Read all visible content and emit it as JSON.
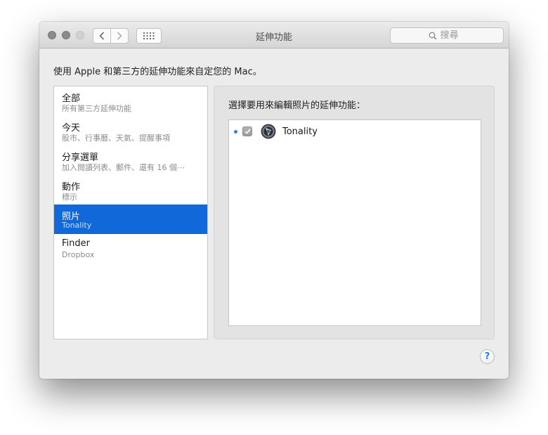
{
  "window": {
    "title": "延伸功能"
  },
  "search": {
    "placeholder": "搜尋"
  },
  "intro_text": "使用 Apple 和第三方的延伸功能來自定您的 Mac。",
  "sidebar": {
    "items": [
      {
        "title": "全部",
        "subtitle": "所有第三方延伸功能",
        "selected": false
      },
      {
        "title": "今天",
        "subtitle": "股市、行事曆、天氣、提醒事項",
        "selected": false
      },
      {
        "title": "分享選單",
        "subtitle": "加入閱讀列表、郵件、還有 16 個⋯",
        "selected": false
      },
      {
        "title": "動作",
        "subtitle": "標示",
        "selected": false
      },
      {
        "title": "照片",
        "subtitle": "Tonality",
        "selected": true
      },
      {
        "title": "Finder",
        "subtitle": "Dropbox",
        "selected": false
      }
    ]
  },
  "panel": {
    "label": "選擇要用來編輯照片的延伸功能：",
    "extensions": [
      {
        "name": "Tonality",
        "checked": true,
        "new_indicator": true
      }
    ]
  },
  "help": {
    "label": "?"
  },
  "colors": {
    "selection": "#1168d9",
    "dot": "#2a82f0"
  }
}
